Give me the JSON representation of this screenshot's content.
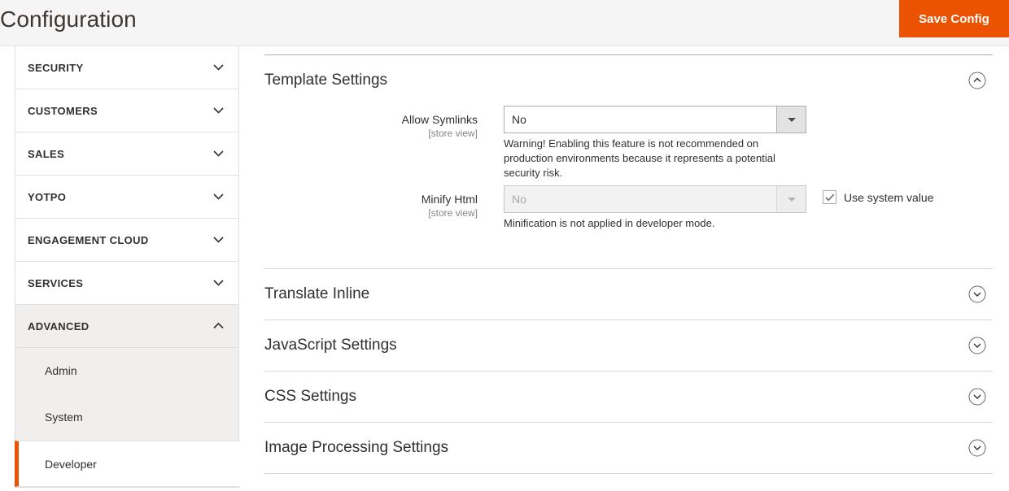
{
  "header": {
    "title": "Configuration",
    "save_label": "Save Config",
    "accent_color": "#eb5202"
  },
  "sidebar": {
    "sections": [
      {
        "label": "SECURITY",
        "icon": "chevron-down-icon",
        "expanded": false
      },
      {
        "label": "CUSTOMERS",
        "icon": "chevron-down-icon",
        "expanded": false
      },
      {
        "label": "SALES",
        "icon": "chevron-down-icon",
        "expanded": false
      },
      {
        "label": "YOTPO",
        "icon": "chevron-down-icon",
        "expanded": false
      },
      {
        "label": "ENGAGEMENT CLOUD",
        "icon": "chevron-down-icon",
        "expanded": false
      },
      {
        "label": "SERVICES",
        "icon": "chevron-down-icon",
        "expanded": false
      },
      {
        "label": "ADVANCED",
        "icon": "chevron-up-icon",
        "expanded": true
      }
    ],
    "advanced_items": [
      {
        "label": "Admin",
        "active": false
      },
      {
        "label": "System",
        "active": false
      },
      {
        "label": "Developer",
        "active": true
      }
    ]
  },
  "content": {
    "template_settings": {
      "title": "Template Settings",
      "toggle_icon": "circle-chevron-up-icon",
      "fields": [
        {
          "label": "Allow Symlinks",
          "scope": "[store view]",
          "value": "No",
          "note": "Warning! Enabling this feature is not recommended on production environments because it represents a potential security risk.",
          "disabled": false,
          "use_system_value": null
        },
        {
          "label": "Minify Html",
          "scope": "[store view]",
          "value": "No",
          "note": "Minification is not applied in developer mode.",
          "disabled": true,
          "use_system_value": "Use system value"
        }
      ]
    },
    "collapsed_sections": [
      {
        "title": "Translate Inline",
        "toggle_icon": "circle-chevron-down-icon"
      },
      {
        "title": "JavaScript Settings",
        "toggle_icon": "circle-chevron-down-icon"
      },
      {
        "title": "CSS Settings",
        "toggle_icon": "circle-chevron-down-icon"
      },
      {
        "title": "Image Processing Settings",
        "toggle_icon": "circle-chevron-down-icon"
      }
    ]
  }
}
